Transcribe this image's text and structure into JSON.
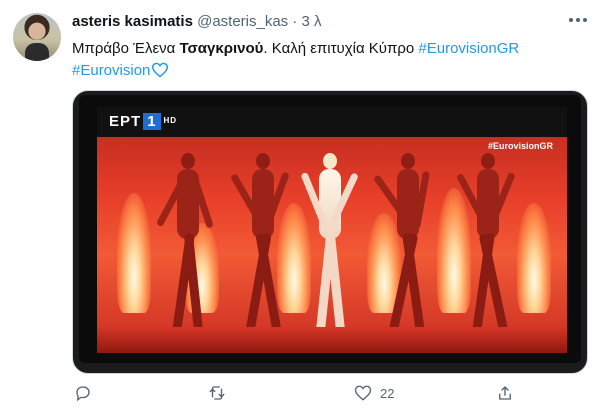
{
  "tweet": {
    "author_name": "asteris kasimatis",
    "handle": "@asteris_kas",
    "separator": "·",
    "time": "3 λ",
    "text_segments": [
      {
        "text": "Μπράβο Έλενα ",
        "style": "normal"
      },
      {
        "text": "Τσαγκρινού",
        "style": "bold"
      },
      {
        "text": ". Καλή επιτυχία Κύπρο ",
        "style": "normal"
      },
      {
        "text": "#EurovisionGR",
        "style": "tag"
      },
      {
        "text": "#Eurovision",
        "style": "tag"
      }
    ],
    "media": {
      "channel_logo": "ΕΡΤ",
      "channel_number": "1",
      "hd_label": "HD",
      "hashtag_overlay": "#EurovisionGR"
    },
    "actions": {
      "reply_count": "",
      "retweet_count": "",
      "like_count": "22",
      "share_count": ""
    },
    "colors": {
      "link": "#1d9bf0",
      "muted": "#536471",
      "text": "#0f1419"
    },
    "icons": [
      "more-icon",
      "reply-icon",
      "retweet-icon",
      "like-icon",
      "share-icon",
      "blue-heart-icon"
    ]
  }
}
